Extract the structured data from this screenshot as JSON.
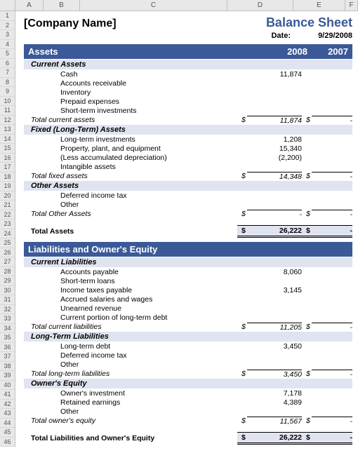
{
  "columns": [
    "A",
    "B",
    "C",
    "D",
    "E",
    "F"
  ],
  "company": "[Company Name]",
  "title": "Balance Sheet",
  "date_label": "Date:",
  "date_value": "9/29/2008",
  "years": {
    "y1": "2008",
    "y2": "2007"
  },
  "assets": {
    "header": "Assets",
    "current": {
      "header": "Current Assets",
      "items": [
        {
          "label": "Cash",
          "v1": "11,874",
          "v2": ""
        },
        {
          "label": "Accounts receivable",
          "v1": "",
          "v2": ""
        },
        {
          "label": "Inventory",
          "v1": "",
          "v2": ""
        },
        {
          "label": "Prepaid expenses",
          "v1": "",
          "v2": ""
        },
        {
          "label": "Short-term investments",
          "v1": "",
          "v2": ""
        }
      ],
      "total": {
        "label": "Total current assets",
        "v1": "11,874",
        "v2": "-"
      }
    },
    "fixed": {
      "header": "Fixed (Long-Term) Assets",
      "items": [
        {
          "label": "Long-term investments",
          "v1": "1,208",
          "v2": ""
        },
        {
          "label": "Property, plant, and equipment",
          "v1": "15,340",
          "v2": ""
        },
        {
          "label": "(Less accumulated depreciation)",
          "v1": "(2,200)",
          "v2": ""
        },
        {
          "label": "Intangible assets",
          "v1": "",
          "v2": ""
        }
      ],
      "total": {
        "label": "Total fixed assets",
        "v1": "14,348",
        "v2": "-"
      }
    },
    "other": {
      "header": "Other Assets",
      "items": [
        {
          "label": "Deferred income tax",
          "v1": "",
          "v2": ""
        },
        {
          "label": "Other",
          "v1": "",
          "v2": ""
        }
      ],
      "total": {
        "label": "Total Other Assets",
        "v1": "-",
        "v2": "-"
      }
    },
    "grand": {
      "label": "Total Assets",
      "v1": "26,222",
      "v2": "-"
    }
  },
  "liab": {
    "header": "Liabilities and Owner's Equity",
    "current": {
      "header": "Current Liabilities",
      "items": [
        {
          "label": "Accounts payable",
          "v1": "8,060",
          "v2": ""
        },
        {
          "label": "Short-term loans",
          "v1": "",
          "v2": ""
        },
        {
          "label": "Income taxes payable",
          "v1": "3,145",
          "v2": ""
        },
        {
          "label": "Accrued salaries and wages",
          "v1": "",
          "v2": ""
        },
        {
          "label": "Unearned revenue",
          "v1": "",
          "v2": ""
        },
        {
          "label": "Current portion of long-term debt",
          "v1": "",
          "v2": ""
        }
      ],
      "total": {
        "label": "Total current liabilities",
        "v1": "11,205",
        "v2": "-"
      }
    },
    "longterm": {
      "header": "Long-Term Liabilities",
      "items": [
        {
          "label": "Long-term debt",
          "v1": "3,450",
          "v2": ""
        },
        {
          "label": "Deferred income tax",
          "v1": "",
          "v2": ""
        },
        {
          "label": "Other",
          "v1": "",
          "v2": ""
        }
      ],
      "total": {
        "label": "Total long-term liabilities",
        "v1": "3,450",
        "v2": "-"
      }
    },
    "equity": {
      "header": "Owner's Equity",
      "items": [
        {
          "label": "Owner's investment",
          "v1": "7,178",
          "v2": ""
        },
        {
          "label": "Retained earnings",
          "v1": "4,389",
          "v2": ""
        },
        {
          "label": "Other",
          "v1": "",
          "v2": ""
        }
      ],
      "total": {
        "label": "Total owner's equity",
        "v1": "11,567",
        "v2": "-"
      }
    },
    "grand": {
      "label": "Total Liabilities and Owner's Equity",
      "v1": "26,222",
      "v2": "-"
    }
  },
  "currency": "$"
}
